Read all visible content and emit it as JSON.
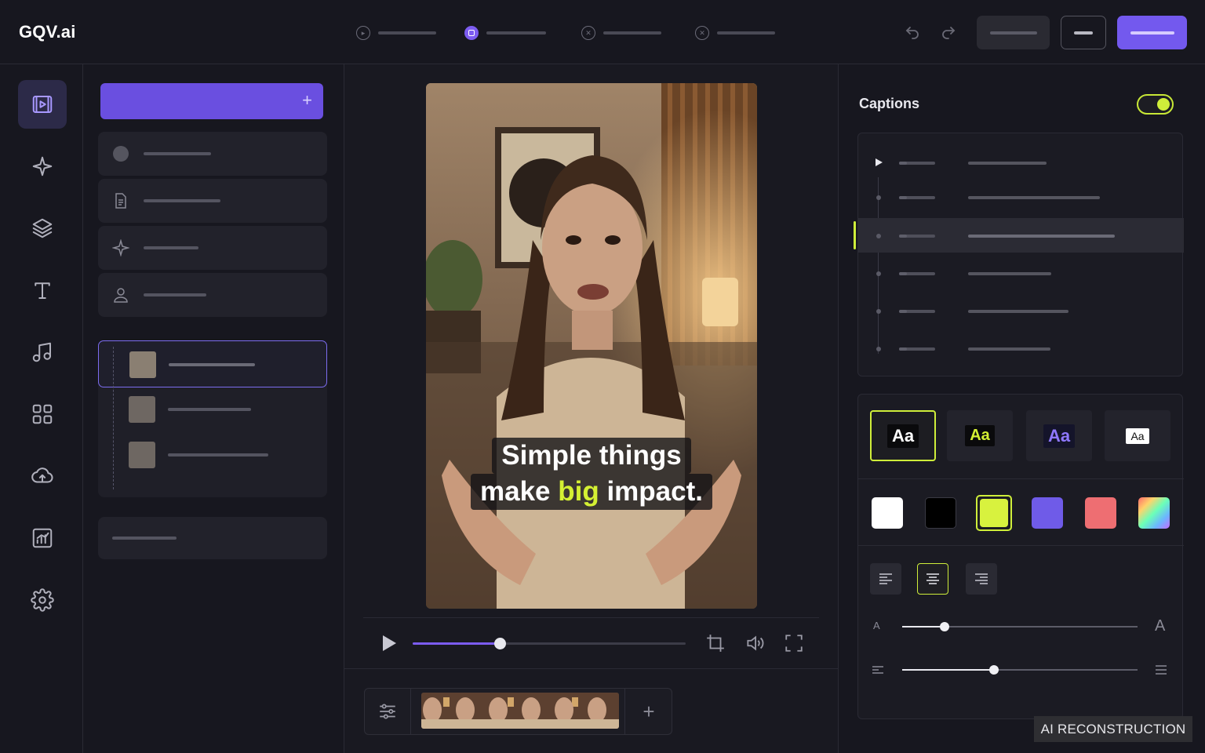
{
  "app": {
    "logo": "GQV.ai"
  },
  "header": {
    "steps": [
      {
        "state": "pending"
      },
      {
        "state": "active"
      },
      {
        "state": "error"
      },
      {
        "state": "error"
      }
    ],
    "undo_icon": "undo-icon",
    "redo_icon": "redo-icon",
    "accent": "#7c5cf0"
  },
  "rail": {
    "items": [
      "video-icon",
      "sparkle-icon",
      "layers-icon",
      "text-icon",
      "music-icon",
      "grid-icon",
      "upload-icon",
      "chart-icon",
      "gear-icon"
    ]
  },
  "panel": {
    "new_button_icon": "+",
    "items": [
      "circle-icon",
      "document-icon",
      "sparkle-icon",
      "user-icon"
    ]
  },
  "preview": {
    "caption_line1": "Simple things",
    "caption_line2_a": "make ",
    "caption_highlight": "big",
    "caption_line2_b": " impact.",
    "progress": 0.32,
    "timeline_add": "+"
  },
  "captions": {
    "title": "Captions",
    "enabled": true,
    "toggle_color": "#cfee3a"
  },
  "style": {
    "presets": [
      "Aa",
      "Aa",
      "Aa",
      "Aa"
    ],
    "swatches": [
      "#ffffff",
      "#000000",
      "#d8f23e",
      "#6f5be8",
      "#ee6e72",
      "gradient"
    ],
    "size_small": "A",
    "size_large": "A",
    "size_value": 0.18,
    "spacing_value": 0.39
  },
  "badge": "AI RECONSTRUCTION"
}
